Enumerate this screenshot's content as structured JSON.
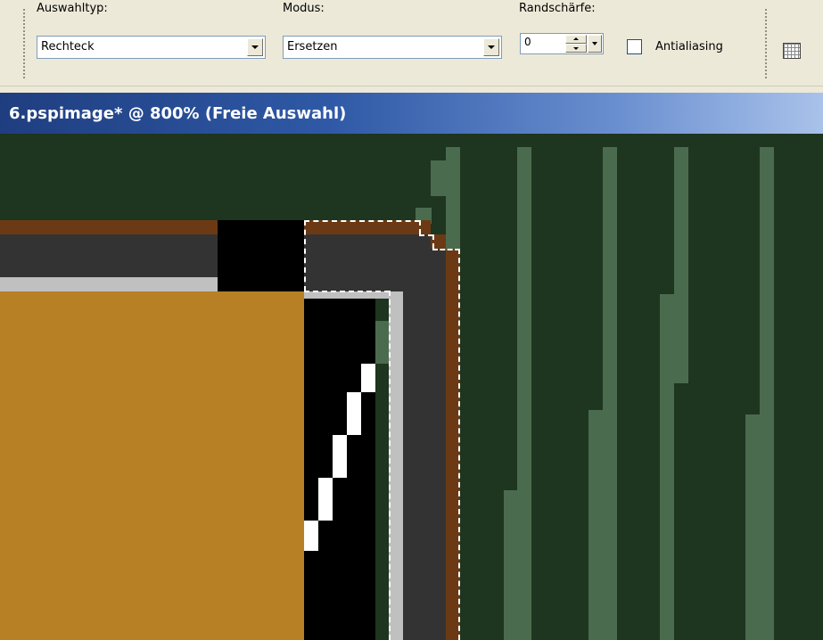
{
  "toolbar": {
    "selection_type": {
      "label": "Auswahltyp:",
      "value": "Rechteck"
    },
    "mode": {
      "label": "Modus:",
      "value": "Ersetzen"
    },
    "feather": {
      "label": "Randschärfe:",
      "value": "0"
    },
    "antialias": {
      "label": "Antialiasing",
      "checked": false
    }
  },
  "document": {
    "title": "6.pspimage* @ 800% (Freie Auswahl)"
  },
  "colors": {
    "dark_green": "#1e3520",
    "light_green": "#4b6b4f",
    "brown": "#6b3a14",
    "charcoal": "#333333",
    "silver": "#c0c0c0",
    "gold": "#b88024",
    "black": "#000000",
    "title_bar": "#2f59a6"
  },
  "icons": {
    "dropdown": "chevron-down-icon",
    "spinner": "spin-arrows-icon",
    "grid": "grid-icon"
  }
}
